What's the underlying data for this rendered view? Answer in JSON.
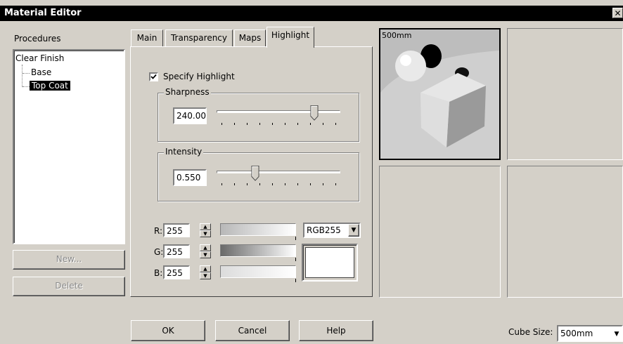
{
  "window": {
    "title": "Material Editor",
    "close_glyph": "✕"
  },
  "procedures": {
    "label": "Procedures",
    "tree": [
      {
        "label": "Clear Finish",
        "level": 0,
        "selected": false
      },
      {
        "label": "Base",
        "level": 1,
        "selected": false
      },
      {
        "label": "Top Coat",
        "level": 1,
        "selected": true
      }
    ],
    "new_label": "New...",
    "delete_label": "Delete"
  },
  "tabs": [
    {
      "label": "Main",
      "active": false
    },
    {
      "label": "Transparency",
      "active": false
    },
    {
      "label": "Maps",
      "active": false
    },
    {
      "label": "Highlight",
      "active": true
    }
  ],
  "highlight": {
    "specify_label": "Specify Highlight",
    "specify_checked": true,
    "sharpness": {
      "label": "Sharpness",
      "value": "240.00",
      "fraction": 0.79
    },
    "intensity": {
      "label": "Intensity",
      "value": "0.550",
      "fraction": 0.31
    },
    "color": {
      "r_label": "R:",
      "r_value": "255",
      "g_label": "G:",
      "g_value": "255",
      "b_label": "B:",
      "b_value": "255",
      "mode": "RGB255",
      "swatch": "#ffffff"
    }
  },
  "preview": {
    "size_label": "500mm"
  },
  "footer": {
    "ok_label": "OK",
    "cancel_label": "Cancel",
    "help_label": "Help",
    "cube_size_label": "Cube Size:",
    "cube_size_value": "500mm"
  }
}
